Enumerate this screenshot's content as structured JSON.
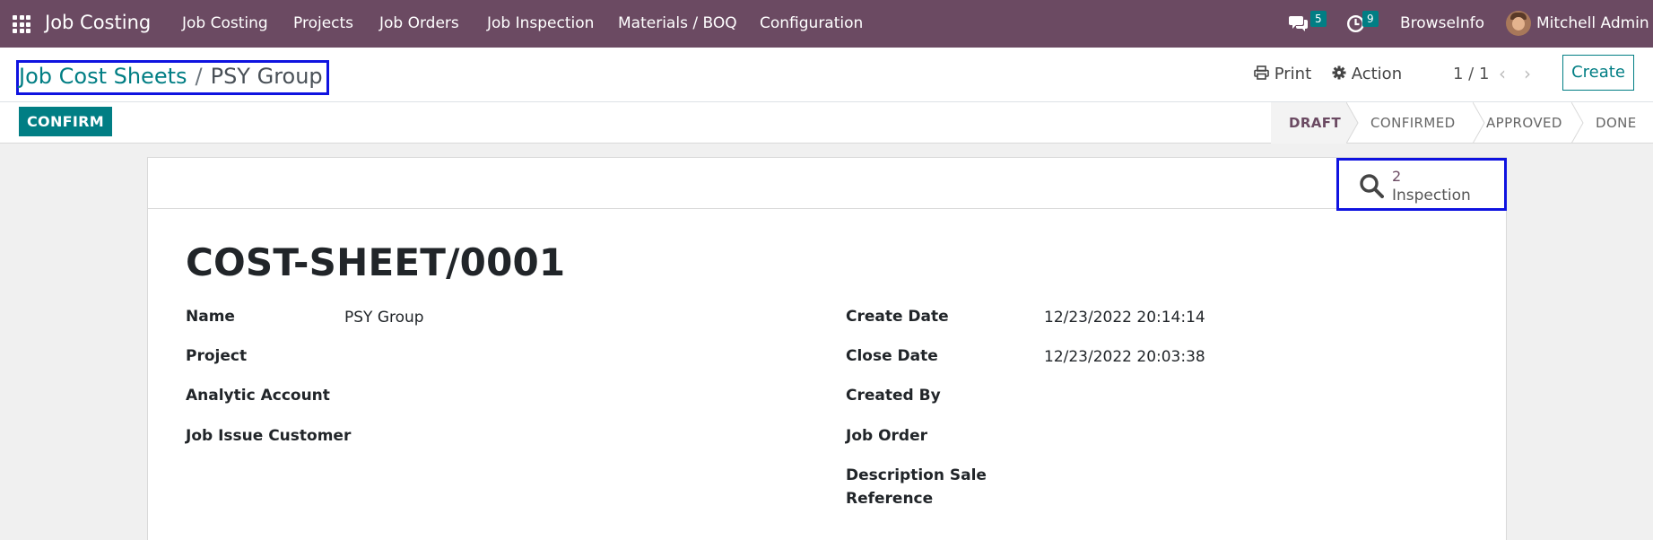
{
  "navbar": {
    "app_title": "Job Costing",
    "menu": [
      "Job Costing",
      "Projects",
      "Job Orders",
      "Job Inspection",
      "Materials / BOQ",
      "Configuration"
    ],
    "messages_count": "5",
    "activities_count": "9",
    "company": "BrowseInfo",
    "user": "Mitchell Admin"
  },
  "control_panel": {
    "breadcrumb_parent": "Job Cost Sheets",
    "breadcrumb_separator": "/",
    "breadcrumb_current": "PSY Group",
    "print_label": "Print",
    "action_label": "Action",
    "pager": "1 / 1",
    "create_label": "Create"
  },
  "statusbar": {
    "confirm_label": "CONFIRM",
    "stages": [
      "DRAFT",
      "CONFIRMED",
      "APPROVED",
      "DONE"
    ],
    "active_stage": "DRAFT"
  },
  "smart_button": {
    "value": "2",
    "label": "Inspection",
    "icon": "search-icon"
  },
  "form": {
    "title": "COST-SHEET/0001",
    "left_fields": [
      {
        "label": "Name",
        "value": "PSY Group"
      },
      {
        "label": "Project",
        "value": ""
      },
      {
        "label": "Analytic Account",
        "value": ""
      },
      {
        "label": "Job Issue Customer",
        "value": ""
      }
    ],
    "right_fields": [
      {
        "label": "Create Date",
        "value": "12/23/2022 20:14:14"
      },
      {
        "label": "Close Date",
        "value": "12/23/2022 20:03:38"
      },
      {
        "label": "Created By",
        "value": ""
      },
      {
        "label": "Job Order",
        "value": ""
      },
      {
        "label_line1": "Description Sale",
        "label_line2": "Reference",
        "value": ""
      }
    ]
  },
  "colors": {
    "navbar": "#6b4a62",
    "accent": "#017e84",
    "highlight_box": "#0f13e0"
  }
}
